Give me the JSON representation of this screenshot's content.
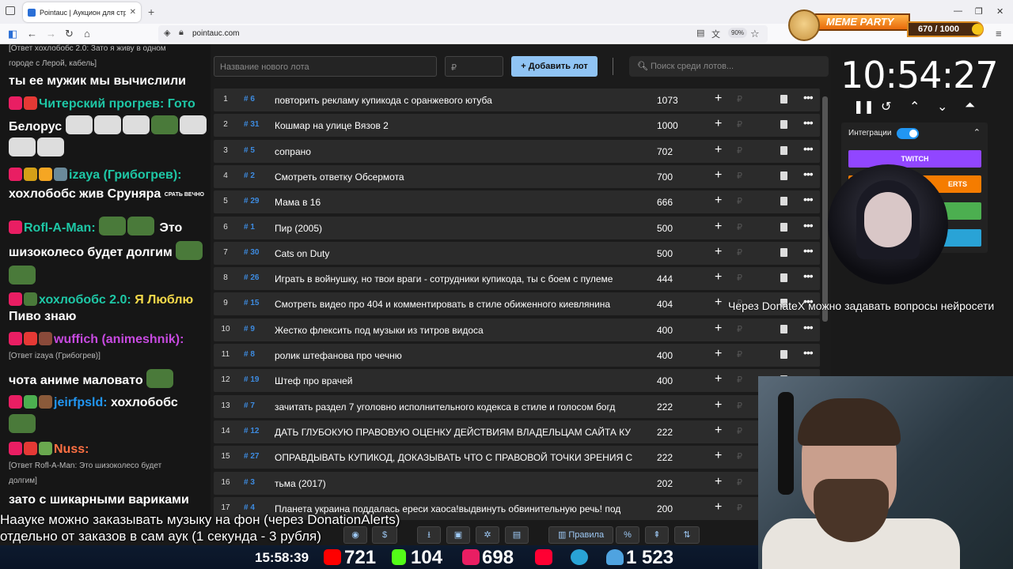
{
  "browser": {
    "tab_title": "Pointauc | Аукцион для стриме",
    "url": "pointauc.com",
    "zoom": "90%"
  },
  "badge": {
    "title": "MEME PARTY",
    "progress": "670 / 1000"
  },
  "chat": {
    "lines": [
      "[Ответ хохлобобс 2.0: Зато я живу в одном",
      "городе с Лерой, кабель]",
      "ты ее мужик мы вычислили",
      "Читерский прогрев: Гото",
      "Белорус",
      "izaya (Грибогрев):",
      "хохлобобс жив Сруняра",
      "Rofl-A-Man:",
      "Это",
      "шизоколесо будет долгим",
      "хохлобобс 2.0:",
      "Я Люблю",
      "Пиво знаю",
      "wuffich (animeshnik):",
      "[Ответ izaya (Грибогрев)]",
      "чота аниме маловато",
      "jeirfpsld:",
      "хохлобобс",
      "Nuss:",
      "[Ответ Rofl-A-Man: Это шизоколесо будет",
      "долгим]",
      "зато с шикарными вариками"
    ],
    "emote_text": "СРАТЬ ВЕЧНО"
  },
  "lot_form": {
    "name_placeholder": "Название нового лота",
    "price_placeholder": "₽",
    "add_label": "Добавить лот",
    "search_placeholder": "Поиск среди лотов..."
  },
  "lots": [
    {
      "n": "1",
      "id": "# 6",
      "name": "повторить рекламу купикода с оранжевого ютуба",
      "amount": "1073"
    },
    {
      "n": "2",
      "id": "# 31",
      "name": "Кошмар на улице Вязов 2",
      "amount": "1000"
    },
    {
      "n": "3",
      "id": "# 5",
      "name": "сопрано",
      "amount": "702"
    },
    {
      "n": "4",
      "id": "# 2",
      "name": "Смотреть ответку Обсермота",
      "amount": "700"
    },
    {
      "n": "5",
      "id": "# 29",
      "name": "Мама в 16",
      "amount": "666"
    },
    {
      "n": "6",
      "id": "# 1",
      "name": "Пир (2005)",
      "amount": "500"
    },
    {
      "n": "7",
      "id": "# 30",
      "name": "Cats on Duty",
      "amount": "500"
    },
    {
      "n": "8",
      "id": "# 26",
      "name": "Играть в войнушку, но твои враги - сотрудники купикода, ты с боем с пулеме",
      "amount": "444"
    },
    {
      "n": "9",
      "id": "# 15",
      "name": "Смотреть видео про 404 и комментировать в стиле обиженного киевлянина",
      "amount": "404"
    },
    {
      "n": "10",
      "id": "# 9",
      "name": "Жестко флексить под музыки из титров видоса",
      "amount": "400"
    },
    {
      "n": "11",
      "id": "# 8",
      "name": " ролик штефанова про чечню",
      "amount": "400"
    },
    {
      "n": "12",
      "id": "# 19",
      "name": "Штеф про врачей",
      "amount": "400"
    },
    {
      "n": "13",
      "id": "# 7",
      "name": "зачитать раздел 7 уголовно исполнительного кодекса в стиле и голосом богд",
      "amount": "222"
    },
    {
      "n": "14",
      "id": "# 12",
      "name": "ДАТЬ ГЛУБОКУЮ ПРАВОВУЮ ОЦЕНКУ ДЕЙСТВИЯМ ВЛАДЕЛЬЦАМ САЙТА КУ",
      "amount": "222"
    },
    {
      "n": "15",
      "id": "# 27",
      "name": "ОПРАВДЫВАТЬ КУПИКОД, ДОКАЗЫВАТЬ ЧТО С ПРАВОВОЙ ТОЧКИ ЗРЕНИЯ С",
      "amount": "222"
    },
    {
      "n": "16",
      "id": "# 3",
      "name": "тьма (2017)",
      "amount": "202"
    },
    {
      "n": "17",
      "id": "# 4",
      "name": "Планета украина поддалась ереси хаоса!выдвинуть обвинительную речь! под",
      "amount": "200"
    }
  ],
  "currency_symbol": "₽",
  "timer": "10:54:27",
  "integrations": {
    "label": "Интеграции",
    "twitch": "TWITCH",
    "donationalerts": "ERTS"
  },
  "overlay": {
    "donatex": "Через DonateX можно задавать вопросы нейросети",
    "line1": "Наауке можно заказывать музыку на фон (через DonationAlerts)",
    "line2": "отдельно от заказов в сам аук (1 секунда - 3 рубля)"
  },
  "toolbar": {
    "rules_label": "Правила",
    "percent_label": "%"
  },
  "stats": {
    "time": "15:58:39",
    "youtube": "721",
    "kick": "104",
    "vk": "698",
    "total": "1 523"
  },
  "colors": {
    "accent_blue": "#90c4f4",
    "twitch": "#9146ff",
    "donationalerts": "#f57c00",
    "green": "#4caf50",
    "cyan": "#29a3d6",
    "id_blue": "#3d8be0"
  }
}
